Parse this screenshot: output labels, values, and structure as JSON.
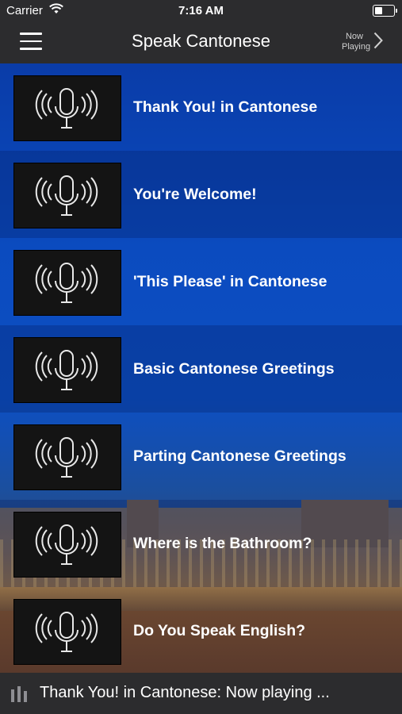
{
  "status_bar": {
    "carrier": "Carrier",
    "time": "7:16 AM"
  },
  "nav": {
    "title": "Speak Cantonese",
    "now_playing_line1": "Now",
    "now_playing_line2": "Playing"
  },
  "items": [
    {
      "label": "Thank You! in Cantonese"
    },
    {
      "label": "You're Welcome!"
    },
    {
      "label": "'This Please' in Cantonese"
    },
    {
      "label": "Basic Cantonese Greetings"
    },
    {
      "label": "Parting Cantonese Greetings"
    },
    {
      "label": "Where is the Bathroom?"
    },
    {
      "label": "Do You Speak English?"
    }
  ],
  "player": {
    "text": "Thank You! in Cantonese: Now playing ..."
  },
  "colors": {
    "bar_bg": "#2c2c2e",
    "list_blue": "#0b4bbf",
    "thumb_bg": "#141414"
  },
  "icons": {
    "menu": "hamburger-icon",
    "now_playing": "chevron-right-icon",
    "item": "microphone-broadcast-icon",
    "player": "audio-bars-icon"
  }
}
